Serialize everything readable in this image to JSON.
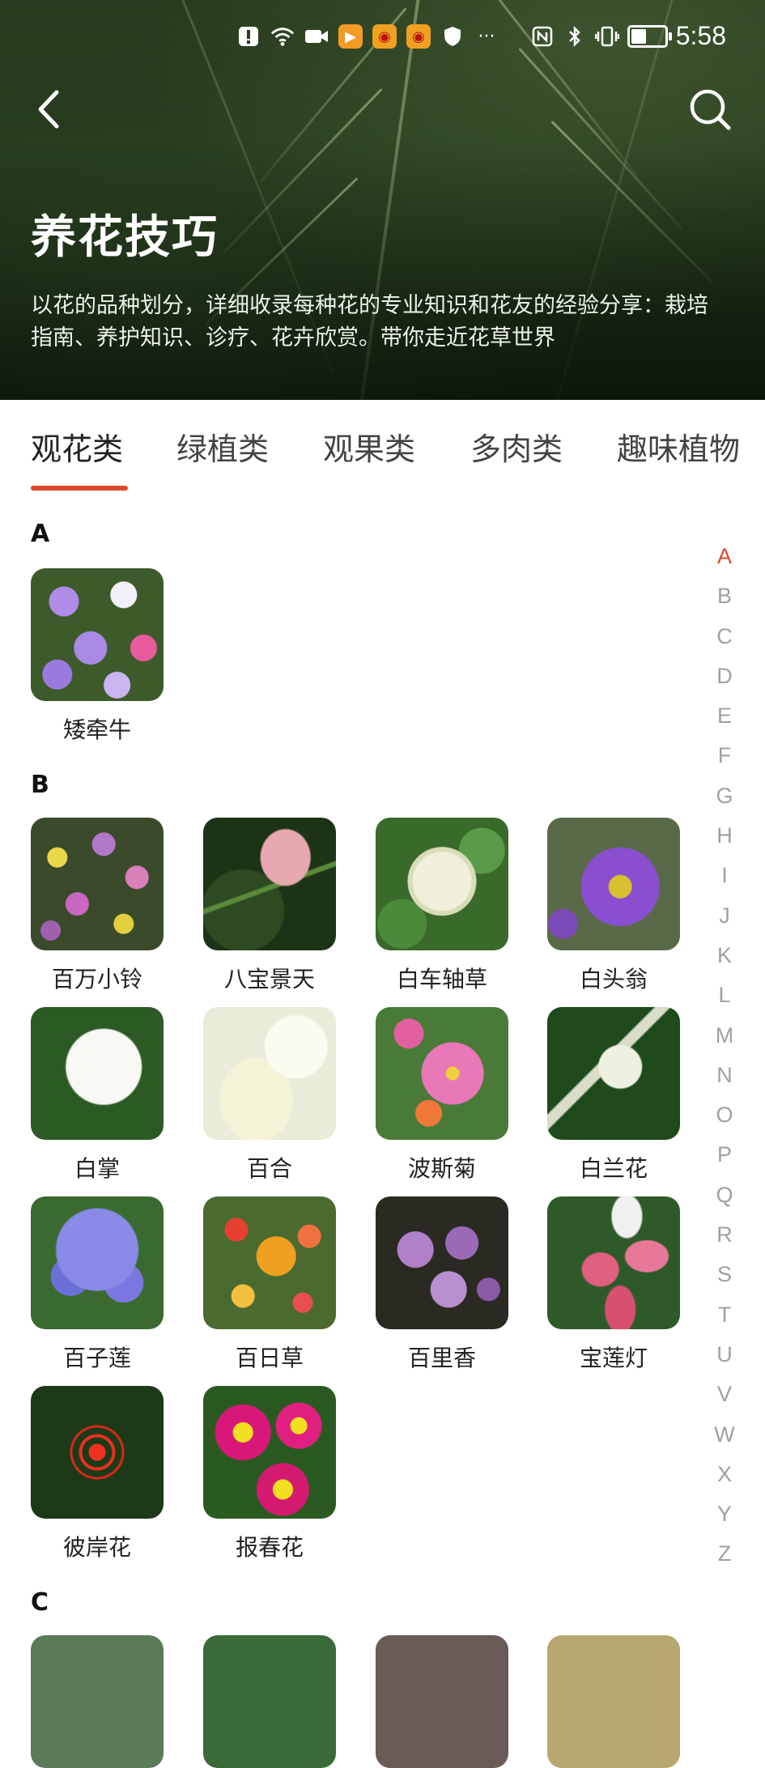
{
  "status_bar": {
    "time": "5:58",
    "icons_left": [
      "alert-icon",
      "wifi-icon",
      "video-icon",
      "app-icon",
      "weibo-icon",
      "weibo-icon",
      "shield-icon",
      "more-icon"
    ],
    "icons_right": [
      "nfc-icon",
      "bluetooth-icon",
      "vibrate-icon",
      "battery-icon"
    ],
    "battery_level": 0.45
  },
  "header": {
    "title": "养花技巧",
    "description": "以花的品种划分，详细收录每种花的专业知识和花友的经验分享：栽培指南、养护知识、诊疗、花卉欣赏。带你走近花草世界"
  },
  "tabs": [
    "观花类",
    "绿植类",
    "观果类",
    "多肉类",
    "趣味植物"
  ],
  "active_tab": 0,
  "sections": [
    {
      "letter": "A",
      "items": [
        "矮牵牛"
      ]
    },
    {
      "letter": "B",
      "items": [
        "百万小铃",
        "八宝景天",
        "白车轴草",
        "白头翁",
        "白掌",
        "百合",
        "波斯菊",
        "白兰花",
        "百子莲",
        "百日草",
        "百里香",
        "宝莲灯",
        "彼岸花",
        "报春花"
      ]
    },
    {
      "letter": "C",
      "items": [
        "",
        "",
        "",
        ""
      ]
    }
  ],
  "alphabet": [
    "A",
    "B",
    "C",
    "D",
    "E",
    "F",
    "G",
    "H",
    "I",
    "J",
    "K",
    "L",
    "M",
    "N",
    "O",
    "P",
    "Q",
    "R",
    "S",
    "T",
    "U",
    "V",
    "W",
    "X",
    "Y",
    "Z"
  ],
  "alphabet_active": "A"
}
